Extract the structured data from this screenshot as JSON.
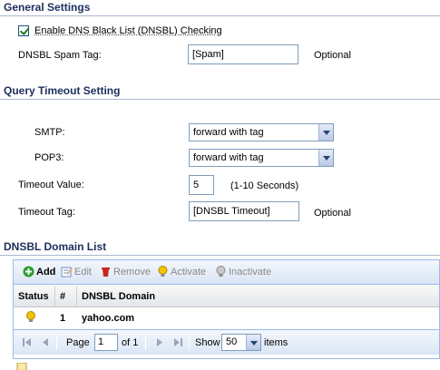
{
  "general": {
    "title": "General Settings",
    "enable_dnsbl_label": "Enable DNS Black List (DNSBL) Checking",
    "enable_dnsbl_checked": true,
    "spam_tag_label": "DNSBL Spam Tag:",
    "spam_tag_value": "[Spam]",
    "spam_tag_hint": "Optional"
  },
  "query_timeout": {
    "title": "Query Timeout Setting",
    "smtp_label": "SMTP:",
    "smtp_value": "forward with tag",
    "pop3_label": "POP3:",
    "pop3_value": "forward with tag",
    "timeout_value_label": "Timeout Value:",
    "timeout_value": "5",
    "timeout_value_hint": "(1-10 Seconds)",
    "timeout_tag_label": "Timeout Tag:",
    "timeout_tag_value": "[DNSBL Timeout]",
    "timeout_tag_hint": "Optional"
  },
  "domain_list": {
    "title": "DNSBL Domain List",
    "toolbar": {
      "add": "Add",
      "edit": "Edit",
      "remove": "Remove",
      "activate": "Activate",
      "inactivate": "Inactivate"
    },
    "columns": [
      "Status",
      "#",
      "DNSBL Domain"
    ],
    "rows": [
      {
        "status": "active",
        "index": "1",
        "domain": "yahoo.com"
      }
    ],
    "paging": {
      "page_label": "Page",
      "page_value": "1",
      "of_label": "of 1",
      "show_label": "Show",
      "show_value": "50",
      "items_label": "items"
    }
  },
  "colors": {
    "section_title": "#1c2f5d",
    "add_green": "#2e9e2e",
    "remove_red": "#c8261e",
    "bulb_yellow": "#f2c200"
  }
}
